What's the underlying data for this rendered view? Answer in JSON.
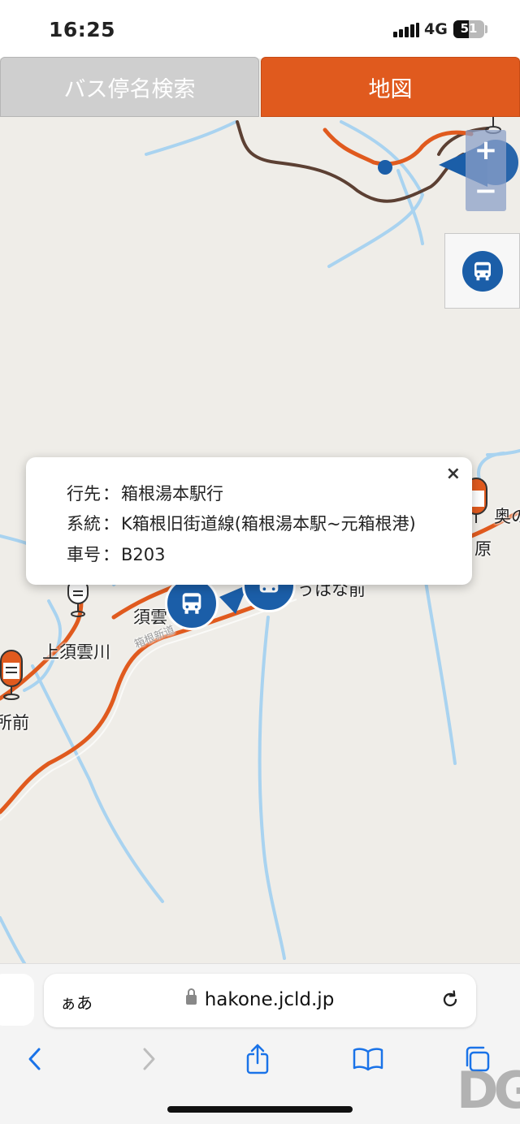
{
  "status_bar": {
    "time": "16:25",
    "network": "4G",
    "battery": "51"
  },
  "tabs": [
    {
      "label": "バス停名検索",
      "active": false
    },
    {
      "label": "地図",
      "active": true
    }
  ],
  "map": {
    "zoom_in": "+",
    "zoom_out": "−",
    "stop_labels": {
      "kami_sugumo": "上須雲川",
      "sugumo": "須雲",
      "hana_mae": "うはな前",
      "okuno": "奥の",
      "hara": "原",
      "sho_mae": "所前"
    },
    "route_road_label": "箱根新道"
  },
  "popup": {
    "close": "×",
    "rows": [
      {
        "label": "行先",
        "sep": "：",
        "value": "箱根湯本駅行"
      },
      {
        "label": "系統",
        "sep": "：",
        "value": "K箱根旧街道線(箱根湯本駅~元箱根港)"
      },
      {
        "label": "車号",
        "sep": "：",
        "value": "B203"
      }
    ]
  },
  "browser": {
    "text_size": "ぁあ",
    "url": "hakone.jcld.jp"
  },
  "watermark": "DG",
  "colors": {
    "tab_active": "#e05a1e",
    "tab_inactive": "#cfcfcf",
    "route_orange": "#e05a1e",
    "road_brown": "#5c4033",
    "river": "#a9d3f0",
    "bus_blue": "#1b5ea8"
  }
}
